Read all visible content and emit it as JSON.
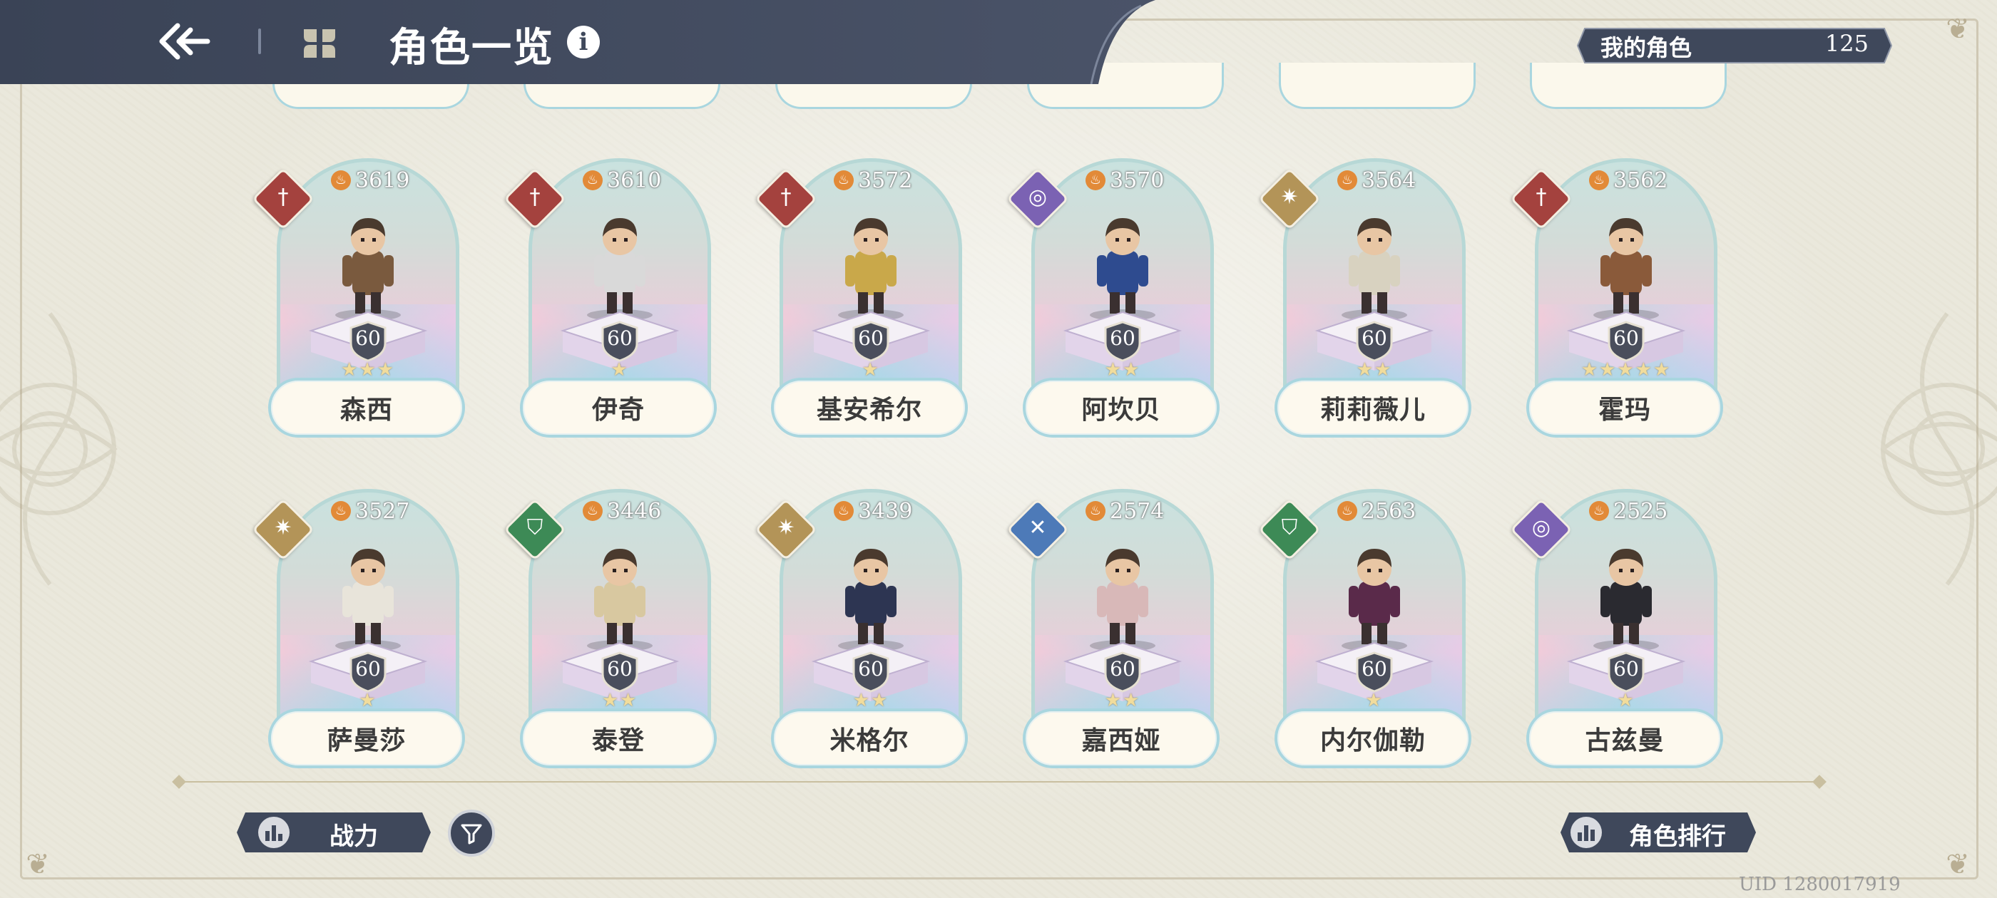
{
  "header": {
    "title": "角色一览",
    "info_icon": "i",
    "back_icon": "back-arrow-icon",
    "grid_icon": "grid-view-icon"
  },
  "my_characters": {
    "label": "我的角色",
    "count": "125"
  },
  "colors": {
    "header_bg": "#3f485b",
    "accent_blue": "#a9d6df",
    "element_red": "#a4423e",
    "element_purple": "#7b62b3",
    "element_gold": "#b39458",
    "element_green": "#3d8a56",
    "element_blue": "#4d7ab8"
  },
  "cards": [
    {
      "name": "森西",
      "power": "3619",
      "level": "60",
      "stars": "★★★",
      "element": "sword",
      "element_color": "#a4423e",
      "sprite_color": "#7a5a3e"
    },
    {
      "name": "伊奇",
      "power": "3610",
      "level": "60",
      "stars": "★",
      "element": "sword",
      "element_color": "#a4423e",
      "sprite_color": "#d9d9d9"
    },
    {
      "name": "基安希尔",
      "power": "3572",
      "level": "60",
      "stars": "★",
      "element": "sword",
      "element_color": "#a4423e",
      "sprite_color": "#c9a84a"
    },
    {
      "name": "阿坎贝",
      "power": "3570",
      "level": "60",
      "stars": "★★",
      "element": "arcane",
      "element_color": "#7b62b3",
      "sprite_color": "#2e4b8f"
    },
    {
      "name": "莉莉薇儿",
      "power": "3564",
      "level": "60",
      "stars": "★★",
      "element": "light",
      "element_color": "#b39458",
      "sprite_color": "#d8d2c0"
    },
    {
      "name": "霍玛",
      "power": "3562",
      "level": "60",
      "stars": "★★★★★",
      "element": "sword",
      "element_color": "#a4423e",
      "sprite_color": "#8a5a3a"
    },
    {
      "name": "萨曼莎",
      "power": "3527",
      "level": "60",
      "stars": "★",
      "element": "light",
      "element_color": "#b39458",
      "sprite_color": "#e8e4da"
    },
    {
      "name": "泰登",
      "power": "3446",
      "level": "60",
      "stars": "★★",
      "element": "shield",
      "element_color": "#3d8a56",
      "sprite_color": "#d8c8a0"
    },
    {
      "name": "米格尔",
      "power": "3439",
      "level": "60",
      "stars": "★★",
      "element": "light",
      "element_color": "#b39458",
      "sprite_color": "#2d3552"
    },
    {
      "name": "嘉西娅",
      "power": "2574",
      "level": "60",
      "stars": "★★",
      "element": "cross",
      "element_color": "#4d7ab8",
      "sprite_color": "#d8b8b8"
    },
    {
      "name": "内尔伽勒",
      "power": "2563",
      "level": "60",
      "stars": "★",
      "element": "shield",
      "element_color": "#3d8a56",
      "sprite_color": "#5a2a4a"
    },
    {
      "name": "古兹曼",
      "power": "2525",
      "level": "60",
      "stars": "★",
      "element": "arcane",
      "element_color": "#7b62b3",
      "sprite_color": "#2a2a30"
    }
  ],
  "footer": {
    "sort_label": "战力",
    "rank_label": "角色排行",
    "uid": "UID 1280017919"
  }
}
